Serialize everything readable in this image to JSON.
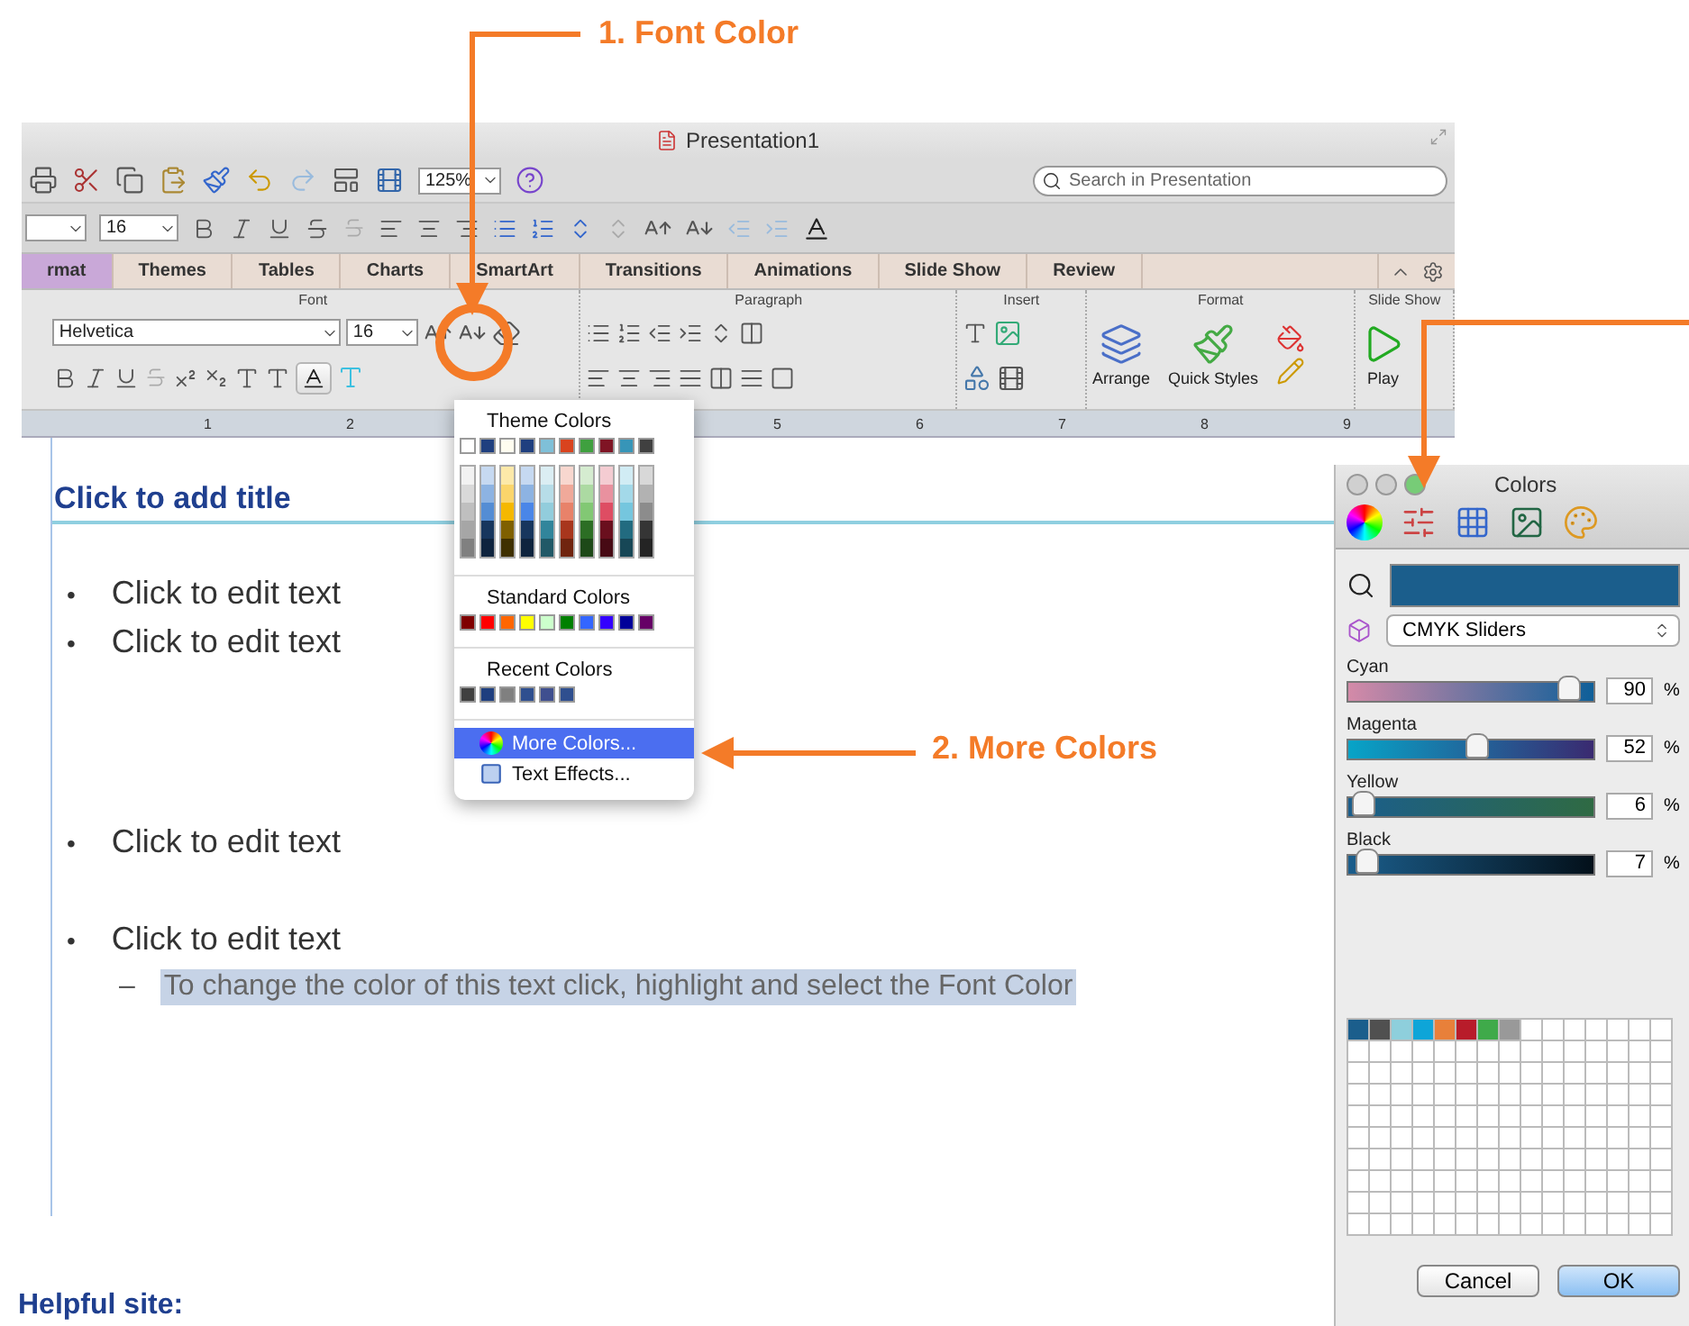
{
  "annotations": [
    {
      "text": "1. Font Color"
    },
    {
      "text": "2. More Colors"
    }
  ],
  "window": {
    "title": "Presentation1"
  },
  "toolbar": {
    "zoom": "125%",
    "search_placeholder": "Search in Presentation"
  },
  "format_bar": {
    "size": "16"
  },
  "ribbon_tabs": [
    {
      "label": "rmat",
      "selected": true
    },
    {
      "label": "Themes",
      "selected": false
    },
    {
      "label": "Tables",
      "selected": false
    },
    {
      "label": "Charts",
      "selected": false
    },
    {
      "label": "SmartArt",
      "selected": false
    },
    {
      "label": "Transitions",
      "selected": false
    },
    {
      "label": "Animations",
      "selected": false
    },
    {
      "label": "Slide Show",
      "selected": false
    },
    {
      "label": "Review",
      "selected": false
    }
  ],
  "ribbon_groups": [
    {
      "kind": "font",
      "title": "Font",
      "font_name": "Helvetica",
      "size": "16"
    },
    {
      "kind": "paragraph",
      "title": "Paragraph"
    },
    {
      "kind": "insert",
      "title": "Insert"
    },
    {
      "kind": "format",
      "title": "Format",
      "buttons": [
        "Arrange",
        "Quick Styles"
      ]
    },
    {
      "kind": "slideshow",
      "title": "Slide Show",
      "button": "Play"
    }
  ],
  "ruler": [
    "1",
    "2",
    "5",
    "6",
    "7",
    "8",
    "9"
  ],
  "slide": {
    "title": "Click to add title",
    "bullets": [
      {
        "marker": "•",
        "text": "Click to edit text"
      },
      {
        "marker": "•",
        "text": "Click to edit text"
      },
      {
        "marker": "•",
        "text": "Click to edit text"
      },
      {
        "marker": "•",
        "text": "Click to edit text",
        "children": [
          {
            "marker": "–",
            "text": "To change the color of this text click, highlight and select the Font Color",
            "selected": true
          }
        ]
      }
    ]
  },
  "color_menu": {
    "theme_title": "Theme Colors",
    "theme_colors": [
      {
        "color": "#ffffff"
      },
      {
        "color": "#1f3f7f"
      },
      {
        "color": "#fffdf0"
      },
      {
        "color": "#1f3f7f"
      },
      {
        "color": "#7fc0d8"
      },
      {
        "color": "#d9431e"
      },
      {
        "color": "#3fa03f"
      },
      {
        "color": "#7f1424"
      },
      {
        "color": "#3795b8"
      },
      {
        "color": "#404040"
      }
    ],
    "theme_shades": [
      {
        "shades": [
          {
            "color": "#f2f2f2"
          },
          {
            "color": "#d9d9d9"
          },
          {
            "color": "#bfbfbf"
          },
          {
            "color": "#a6a6a6"
          },
          {
            "color": "#808080"
          }
        ]
      },
      {
        "shades": [
          {
            "color": "#c6d9f1"
          },
          {
            "color": "#8db3e2"
          },
          {
            "color": "#548dd4"
          },
          {
            "color": "#17365d"
          },
          {
            "color": "#0f243e"
          }
        ]
      },
      {
        "shades": [
          {
            "color": "#fde9a9"
          },
          {
            "color": "#fbd56b"
          },
          {
            "color": "#f5b800"
          },
          {
            "color": "#7f6000"
          },
          {
            "color": "#3f3000"
          }
        ]
      },
      {
        "shades": [
          {
            "color": "#c6d9f1"
          },
          {
            "color": "#8db3e2"
          },
          {
            "color": "#4a86e8"
          },
          {
            "color": "#17365d"
          },
          {
            "color": "#0f243e"
          }
        ]
      },
      {
        "shades": [
          {
            "color": "#dbeef3"
          },
          {
            "color": "#b7dde8"
          },
          {
            "color": "#92cddc"
          },
          {
            "color": "#31859b"
          },
          {
            "color": "#215967"
          }
        ]
      },
      {
        "shades": [
          {
            "color": "#f8d7cf"
          },
          {
            "color": "#f0a99a"
          },
          {
            "color": "#e8826a"
          },
          {
            "color": "#a8361d"
          },
          {
            "color": "#70240f"
          }
        ]
      },
      {
        "shades": [
          {
            "color": "#d5ecd0"
          },
          {
            "color": "#acdaa2"
          },
          {
            "color": "#82c874"
          },
          {
            "color": "#2c6e24"
          },
          {
            "color": "#1d4918"
          }
        ]
      },
      {
        "shades": [
          {
            "color": "#f4ccd2"
          },
          {
            "color": "#e9919f"
          },
          {
            "color": "#de4d63"
          },
          {
            "color": "#6a0f1e"
          },
          {
            "color": "#470a14"
          }
        ]
      },
      {
        "shades": [
          {
            "color": "#d1ecf4"
          },
          {
            "color": "#a3d9e9"
          },
          {
            "color": "#75c6de"
          },
          {
            "color": "#226b80"
          },
          {
            "color": "#174756"
          }
        ]
      },
      {
        "shades": [
          {
            "color": "#d8d8d8"
          },
          {
            "color": "#b2b2b2"
          },
          {
            "color": "#8c8c8c"
          },
          {
            "color": "#353535"
          },
          {
            "color": "#242424"
          }
        ]
      }
    ],
    "standard_title": "Standard Colors",
    "standard_colors": [
      {
        "color": "#7f0000"
      },
      {
        "color": "#ff0000"
      },
      {
        "color": "#ff6600"
      },
      {
        "color": "#ffff00"
      },
      {
        "color": "#ccffcc"
      },
      {
        "color": "#008000"
      },
      {
        "color": "#3366ff"
      },
      {
        "color": "#3300ff"
      },
      {
        "color": "#000099"
      },
      {
        "color": "#660066"
      }
    ],
    "recent_title": "Recent Colors",
    "recent_colors": [
      {
        "color": "#404040"
      },
      {
        "color": "#1f3f7f"
      },
      {
        "color": "#808080"
      },
      {
        "color": "#2f4f8f"
      },
      {
        "color": "#3f4f8f"
      },
      {
        "color": "#2f4f8f"
      }
    ],
    "items": [
      {
        "label": "More Colors...",
        "selected": true
      },
      {
        "label": "Text Effects...",
        "selected": false
      }
    ]
  },
  "colors_panel": {
    "title": "Colors",
    "current_swatch": {
      "color": "#1b5e8c"
    },
    "mode": "CMYK Sliders",
    "sliders": [
      {
        "name": "Cyan",
        "level": 0.9,
        "value": "90",
        "unit": "%"
      },
      {
        "name": "Magenta",
        "level": 0.52,
        "value": "52",
        "unit": "%"
      },
      {
        "name": "Yellow",
        "level": 0.06,
        "value": "6",
        "unit": "%"
      },
      {
        "name": "Black",
        "level": 0.07,
        "value": "7",
        "unit": "%"
      }
    ],
    "saved_colors": [
      {
        "color": "#1b5e8c"
      },
      {
        "color": "#505050"
      },
      {
        "color": "#8ecfdc"
      },
      {
        "color": "#0ea5d8"
      },
      {
        "color": "#e8803a"
      },
      {
        "color": "#b81c2a"
      },
      {
        "color": "#3faa4a"
      },
      {
        "color": "#999999"
      }
    ],
    "buttons": [
      "Cancel",
      "OK"
    ]
  },
  "footer": {
    "text": "Helpful site:"
  }
}
